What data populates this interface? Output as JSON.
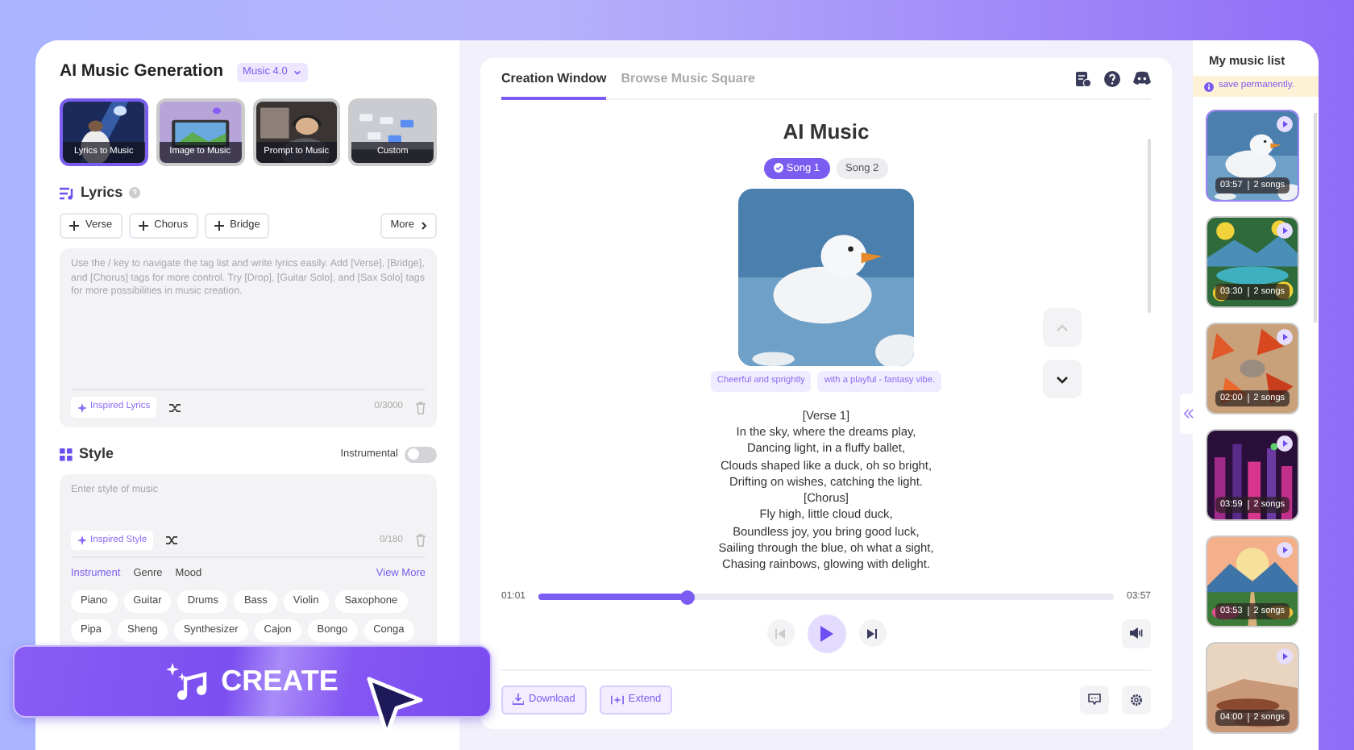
{
  "app": {
    "title": "AI Music Generation",
    "model": "Music 4.0"
  },
  "modes": [
    {
      "label": "Lyrics to Music",
      "selected": true
    },
    {
      "label": "Image to Music",
      "selected": false
    },
    {
      "label": "Prompt to Music",
      "selected": false
    },
    {
      "label": "Custom",
      "selected": false
    }
  ],
  "lyrics": {
    "heading": "Lyrics",
    "tags": [
      "Verse",
      "Chorus",
      "Bridge"
    ],
    "more": "More",
    "placeholder": "Use the / key to navigate the tag list and write lyrics easily. Add [Verse], [Bridge], and [Chorus] tags for more control. Try [Drop], [Guitar Solo], and [Sax Solo] tags for more possibilities in music creation.",
    "inspire": "Inspired Lyrics",
    "counter": "0/3000"
  },
  "style": {
    "heading": "Style",
    "instrumental_label": "Instrumental",
    "instrumental_on": false,
    "placeholder": "Enter style of music",
    "inspire": "Inspired Style",
    "counter": "0/180",
    "categories": [
      {
        "label": "Instrument",
        "selected": true
      },
      {
        "label": "Genre",
        "selected": false
      },
      {
        "label": "Mood",
        "selected": false
      }
    ],
    "view_more": "View More",
    "chips": [
      "Piano",
      "Guitar",
      "Drums",
      "Bass",
      "Violin",
      "Saxophone",
      "Pipa",
      "Sheng",
      "Synthesizer",
      "Cajon",
      "Bongo",
      "Conga"
    ]
  },
  "create": "CREATE",
  "main": {
    "tabs": [
      {
        "label": "Creation Window",
        "selected": true
      },
      {
        "label": "Browse Music Square",
        "selected": false
      }
    ],
    "title": "AI Music",
    "songs": [
      {
        "label": "Song 1",
        "selected": true
      },
      {
        "label": "Song 2",
        "selected": false
      }
    ],
    "mood_tags": [
      "Cheerful and sprightly",
      "with a playful - fantasy vibe."
    ],
    "lyrics": [
      "[Verse 1]",
      "In the sky, where the dreams play,",
      "Dancing light, in a fluffy ballet,",
      "Clouds shaped like a duck, oh so bright,",
      "Drifting on wishes, catching the light.",
      "[Chorus]",
      "Fly high, little cloud duck,",
      "Boundless joy, you bring good luck,",
      "Sailing through the blue, oh what a sight,",
      "Chasing rainbows, glowing with delight."
    ],
    "player": {
      "elapsed": "01:01",
      "total": "03:57",
      "level": 0.26
    },
    "actions": [
      "Download",
      "Extend"
    ]
  },
  "music_list": {
    "title": "My music list",
    "notice": "save permanently.",
    "items": [
      {
        "duration": "03:57",
        "songs": "2 songs",
        "selected": true
      },
      {
        "duration": "03:30",
        "songs": "2 songs",
        "selected": false
      },
      {
        "duration": "02:00",
        "songs": "2 songs",
        "selected": false
      },
      {
        "duration": "03:59",
        "songs": "2 songs",
        "selected": false
      },
      {
        "duration": "03:53",
        "songs": "2 songs",
        "selected": false
      },
      {
        "duration": "04:00",
        "songs": "2 songs",
        "selected": false
      }
    ]
  }
}
